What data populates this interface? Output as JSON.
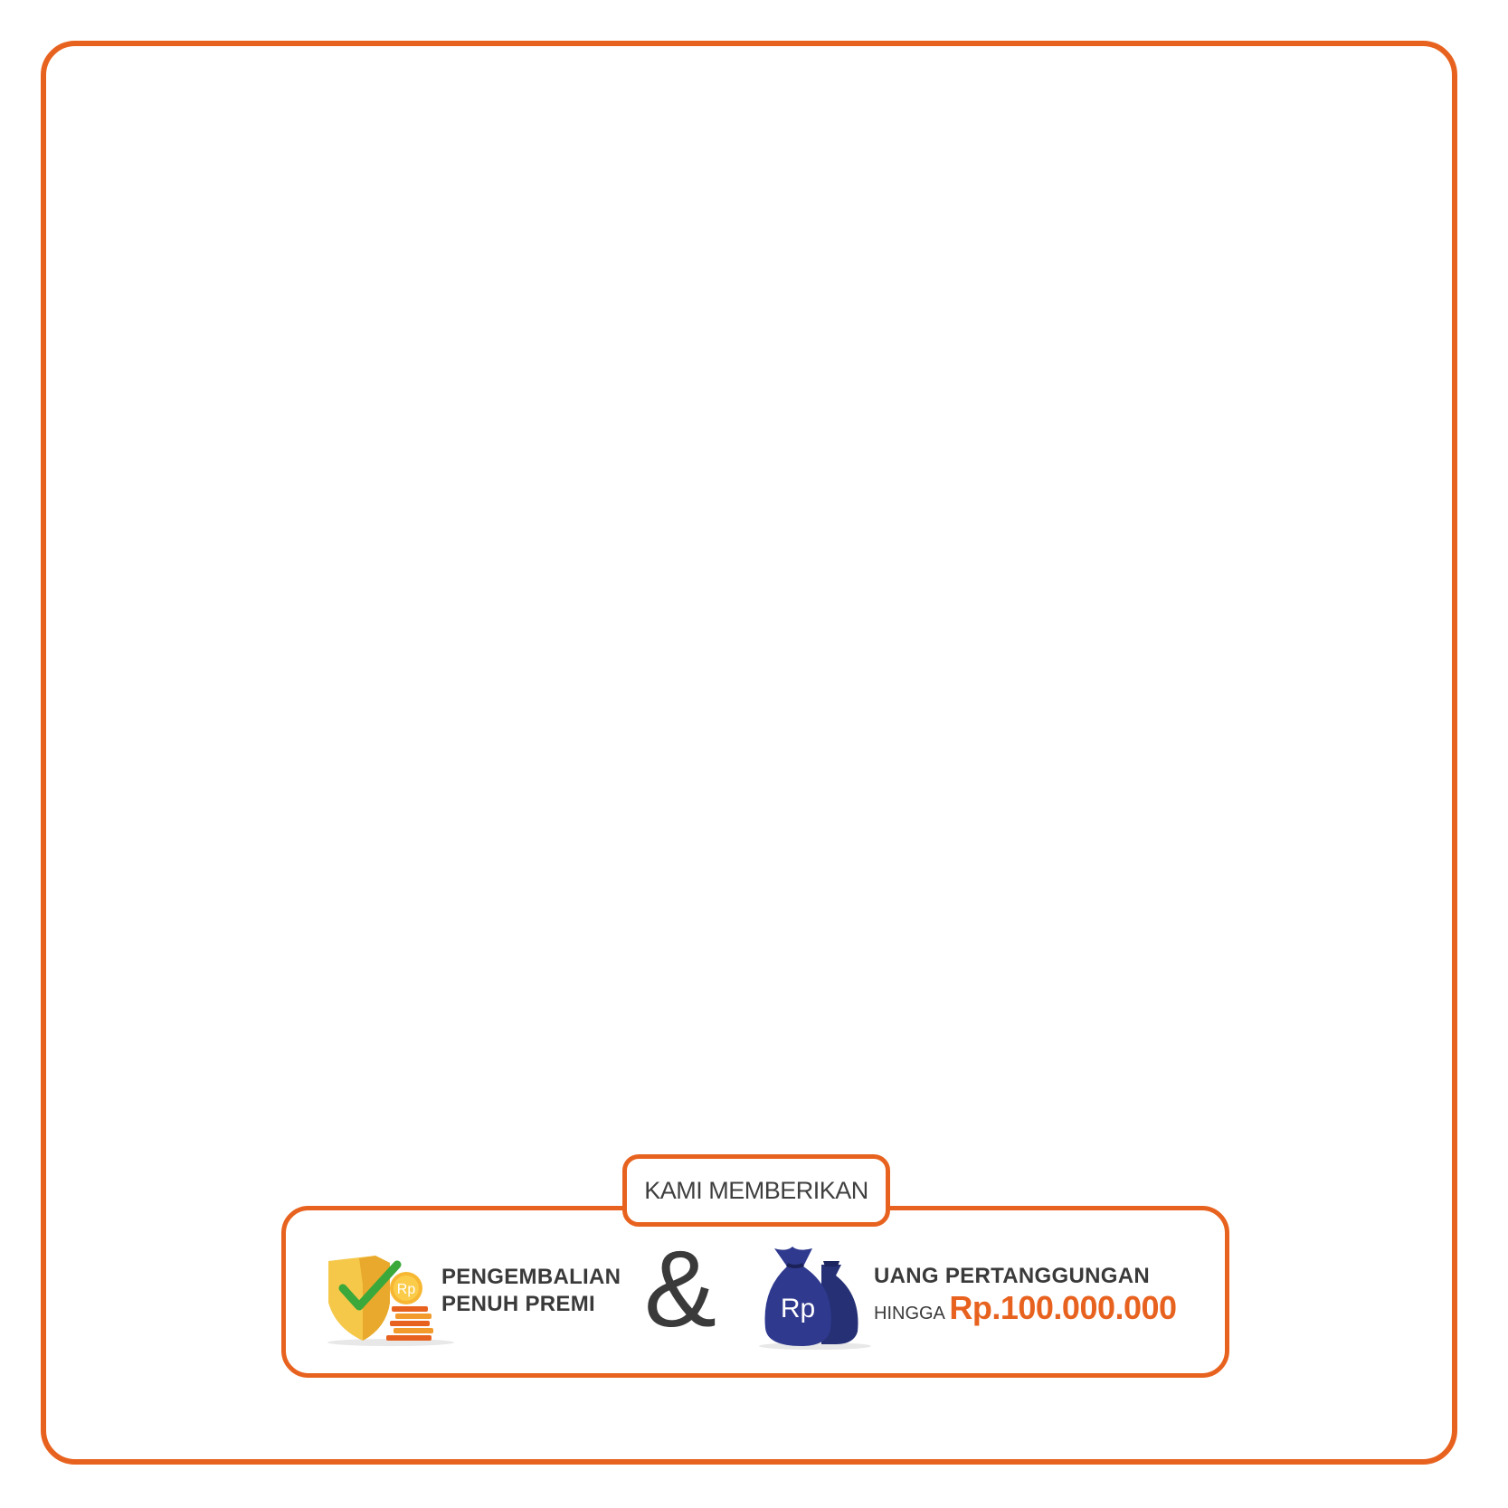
{
  "header": {
    "label": "KAMI MEMBERIKAN"
  },
  "benefits": {
    "refund": {
      "icon": "shield-check-coins-icon",
      "line1": "PENGEMBALIAN",
      "line2": "PENUH PREMI",
      "coin_text": "Rp"
    },
    "separator": "&",
    "sum_assured": {
      "icon": "money-bags-icon",
      "line1": "UANG PERTANGGUNGAN",
      "prefix": "HINGGA",
      "amount": "Rp.100.000.000",
      "bag_text": "Rp"
    }
  },
  "colors": {
    "accent": "#e8621f",
    "text": "#3a3a3a",
    "bag_blue": "#2f3a8f",
    "shield_gold": "#f2b632",
    "check_green": "#3aa83a"
  }
}
